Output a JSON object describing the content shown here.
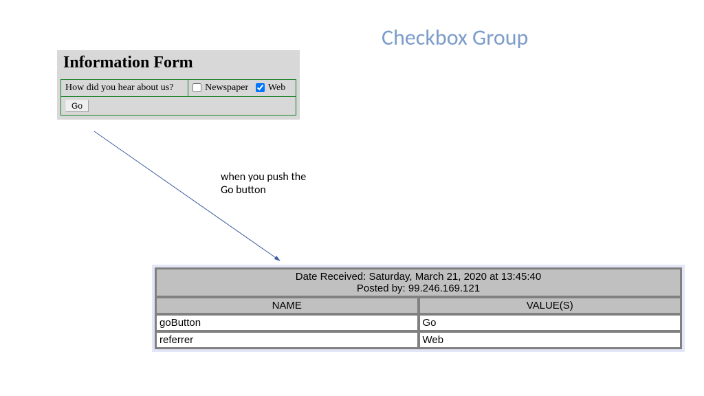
{
  "title": "Checkbox Group",
  "form": {
    "heading": "Information Form",
    "question": "How did you hear about us?",
    "options": [
      {
        "label": "Newspaper",
        "checked": false
      },
      {
        "label": "Web",
        "checked": true
      }
    ],
    "go_label": "Go"
  },
  "annotation": "when you push the Go button",
  "result": {
    "date_line": "Date Received: Saturday, March 21, 2020 at 13:45:40",
    "posted_line": "Posted by: 99.246.169.121",
    "col_name": "NAME",
    "col_value": "VALUE(S)",
    "rows": [
      {
        "name": "goButton",
        "value": "Go"
      },
      {
        "name": "referrer",
        "value": "Web"
      }
    ]
  }
}
